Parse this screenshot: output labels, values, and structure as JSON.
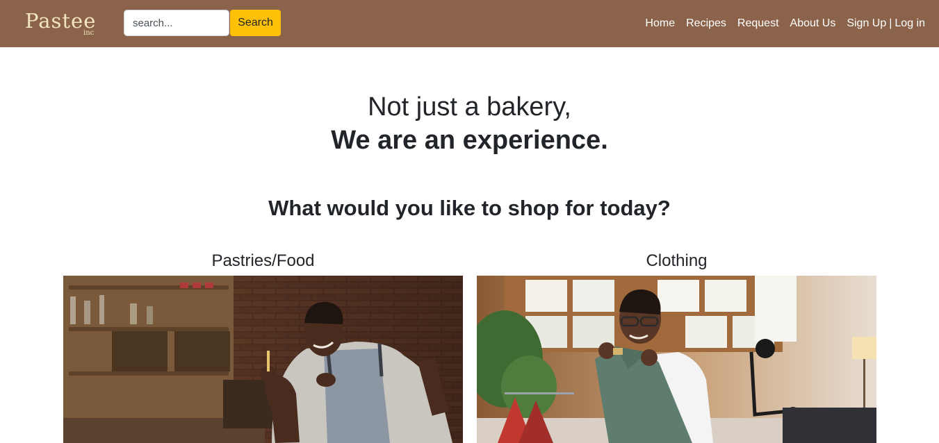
{
  "navbar": {
    "brand": {
      "name": "Pastee",
      "sub": "inc"
    },
    "search": {
      "placeholder": "search...",
      "button_label": "Search"
    },
    "links": {
      "home": "Home",
      "recipes": "Recipes",
      "request": "Request",
      "about": "About Us",
      "signup": "Sign Up",
      "separator": "|",
      "login": "Log in"
    }
  },
  "hero": {
    "line1": "Not just a bakery,",
    "line2": "We are an experience."
  },
  "shop": {
    "title": "What would you like to shop for today?",
    "categories": [
      {
        "title": "Pastries/Food"
      },
      {
        "title": "Clothing"
      }
    ]
  },
  "colors": {
    "navbar_bg": "#8b634b",
    "brand_text": "#f2e5c0",
    "search_button": "#ffc107",
    "text_dark": "#212529"
  }
}
